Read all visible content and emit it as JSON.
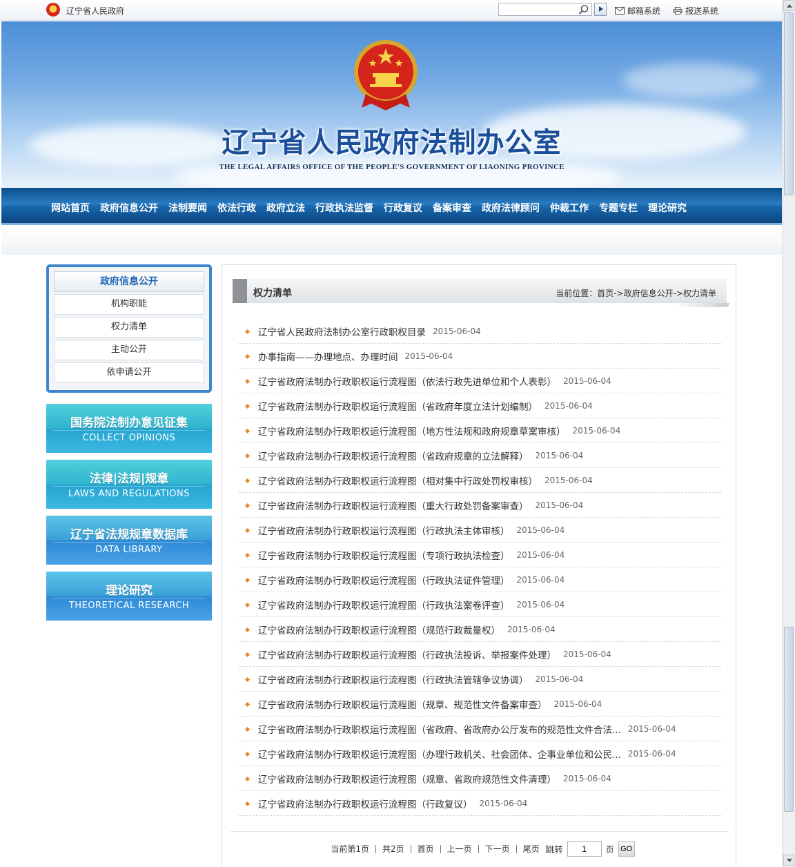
{
  "topbar": {
    "site_name": "辽宁省人民政府",
    "search": {
      "placeholder": "",
      "value": ""
    },
    "mail_label": "邮箱系统",
    "submit_label": "报送系统"
  },
  "banner": {
    "title_cn": "辽宁省人民政府法制办公室",
    "title_en": "THE LEGAL AFFAIRS OFFICE OF THE PEOPLE'S GOVERNMENT OF LIAONING PROVINCE"
  },
  "nav": {
    "items": [
      "网站首页",
      "政府信息公开",
      "法制要闻",
      "依法行政",
      "政府立法",
      "行政执法监督",
      "行政复议",
      "备案审查",
      "政府法律顾问",
      "仲裁工作",
      "专题专栏",
      "理论研究"
    ]
  },
  "sidebar": {
    "heading": "政府信息公开",
    "items": [
      "机构职能",
      "权力清单",
      "主动公开",
      "依申请公开"
    ],
    "promos": [
      {
        "cn": "国务院法制办意见征集",
        "en": "COLLECT OPINIONS"
      },
      {
        "cn": "法律|法规|规章",
        "en": "LAWS AND REGULATIONS"
      },
      {
        "cn": "辽宁省法规规章数据库",
        "en": "DATA LIBRARY"
      },
      {
        "cn": "理论研究",
        "en": "THEORETICAL RESEARCH"
      }
    ]
  },
  "main": {
    "section_title": "权力清单",
    "breadcrumb": "当前位置：首页->政府信息公开->权力清单",
    "articles": [
      {
        "title": "辽宁省人民政府法制办公室行政职权目录",
        "date": "2015-06-04"
      },
      {
        "title": "办事指南——办理地点、办理时间",
        "date": "2015-06-04"
      },
      {
        "title": "辽宁省政府法制办行政职权运行流程图（依法行政先进单位和个人表彰）",
        "date": "2015-06-04"
      },
      {
        "title": "辽宁省政府法制办行政职权运行流程图（省政府年度立法计划编制）",
        "date": "2015-06-04"
      },
      {
        "title": "辽宁省政府法制办行政职权运行流程图（地方性法规和政府规章草案审核）",
        "date": "2015-06-04"
      },
      {
        "title": "辽宁省政府法制办行政职权运行流程图（省政府规章的立法解释）",
        "date": "2015-06-04"
      },
      {
        "title": "辽宁省政府法制办行政职权运行流程图（相对集中行政处罚权审核）",
        "date": "2015-06-04"
      },
      {
        "title": "辽宁省政府法制办行政职权运行流程图（重大行政处罚备案审查）",
        "date": "2015-06-04"
      },
      {
        "title": "辽宁省政府法制办行政职权运行流程图（行政执法主体审核）",
        "date": "2015-06-04"
      },
      {
        "title": "辽宁省政府法制办行政职权运行流程图（专项行政执法检查）",
        "date": "2015-06-04"
      },
      {
        "title": "辽宁省政府法制办行政职权运行流程图（行政执法证件管理）",
        "date": "2015-06-04"
      },
      {
        "title": "辽宁省政府法制办行政职权运行流程图（行政执法案卷评查）",
        "date": "2015-06-04"
      },
      {
        "title": "辽宁省政府法制办行政职权运行流程图（规范行政裁量权）",
        "date": "2015-06-04"
      },
      {
        "title": "辽宁省政府法制办行政职权运行流程图（行政执法投诉、举报案件处理）",
        "date": "2015-06-04"
      },
      {
        "title": "辽宁省政府法制办行政职权运行流程图（行政执法管辖争议协调）",
        "date": "2015-06-04"
      },
      {
        "title": "辽宁省政府法制办行政职权运行流程图（规章、规范性文件备案审查）",
        "date": "2015-06-04"
      },
      {
        "title": "辽宁省政府法制办行政职权运行流程图（省政府、省政府办公厅发布的规范性文件合法...",
        "date": "2015-06-04"
      },
      {
        "title": "辽宁省政府法制办行政职权运行流程图（办理行政机关、社会团体、企事业单位和公民...",
        "date": "2015-06-04"
      },
      {
        "title": "辽宁省政府法制办行政职权运行流程图（规章、省政府规范性文件清理）",
        "date": "2015-06-04"
      },
      {
        "title": "辽宁省政府法制办行政职权运行流程图（行政复议）",
        "date": "2015-06-04"
      }
    ],
    "pager": {
      "current": "当前第1页",
      "total": "共2页",
      "first": "首页",
      "prev": "上一页",
      "next": "下一页",
      "last": "尾页",
      "jump": "跳转",
      "page_value": "1",
      "page_unit": "页",
      "go": "GO"
    }
  },
  "colors": {
    "nav_blue": "#1766ab",
    "sidebar_border": "#3f86cf",
    "bullet": "#e88a2a",
    "promo_teal": "#2fb3cf",
    "promo_blue": "#2c8ad6"
  }
}
